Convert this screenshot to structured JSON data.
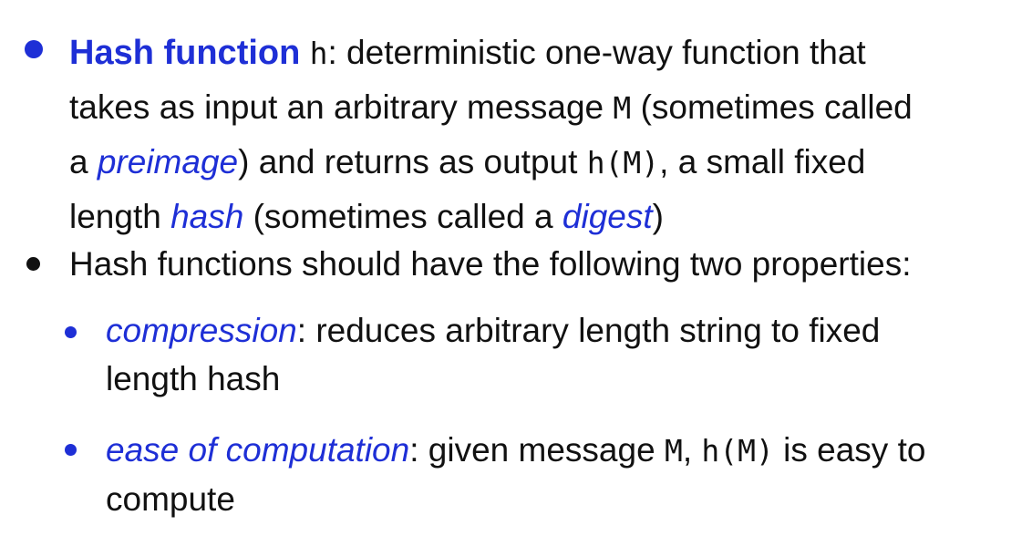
{
  "colors": {
    "accent": "#1e2fd6",
    "text": "#111111",
    "background": "#ffffff"
  },
  "icons": {
    "primary_bullet": "filled-circle",
    "secondary_bullet": "filled-circle"
  },
  "definition": {
    "term": "Hash function",
    "symbol": "h",
    "text_1": ": deterministic one-way function that takes as input an arbitrary message ",
    "message_symbol": "M",
    "text_2": " (sometimes called a ",
    "preimage": "preimage",
    "text_3": ") and returns as output ",
    "output_expr": "h(M)",
    "text_4": ", a small fixed length ",
    "hash_term": "hash",
    "text_5": " (sometimes called a ",
    "digest_term": "digest",
    "text_6": ")"
  },
  "properties_intro": "Hash functions should have the following two properties:",
  "compression": {
    "term": "compression",
    "text": ": reduces arbitrary length string to fixed length hash"
  },
  "ease": {
    "term": "ease of computation",
    "text_1": ": given message ",
    "message_symbol": "M",
    "text_2": ", ",
    "expr": "h(M)",
    "text_3": " is easy to compute"
  }
}
